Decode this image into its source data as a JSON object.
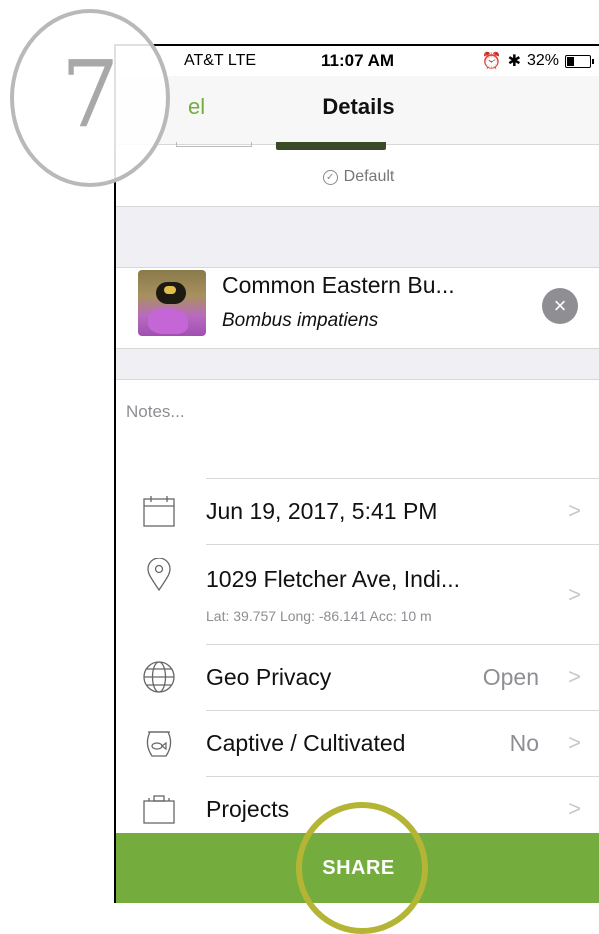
{
  "step": {
    "number": "7"
  },
  "status_bar": {
    "carrier": "AT&T  LTE",
    "time": "11:07 AM",
    "alarm_icon": "alarm-icon",
    "bluetooth_icon": "bluetooth-icon",
    "battery": "32%"
  },
  "nav": {
    "cancel_label": "el",
    "title": "Details"
  },
  "photo": {
    "default_label": "Default"
  },
  "taxon": {
    "common_name": "Common Eastern Bu...",
    "scientific_name": "Bombus impatiens",
    "clear_icon": "clear-icon"
  },
  "notes": {
    "placeholder": "Notes..."
  },
  "rows": {
    "date": {
      "label": "Jun 19, 2017, 5:41 PM",
      "icon": "calendar-icon"
    },
    "location": {
      "label": "1029 Fletcher Ave, Indi...",
      "sub": "Lat: 39.757  Long: -86.141  Acc: 10 m",
      "icon": "map-pin-icon"
    },
    "geo_privacy": {
      "label": "Geo Privacy",
      "value": "Open",
      "icon": "globe-icon"
    },
    "captive": {
      "label": "Captive / Cultivated",
      "value": "No",
      "icon": "fishbowl-icon"
    },
    "projects": {
      "label": "Projects",
      "icon": "briefcase-icon"
    }
  },
  "share": {
    "label": "SHARE"
  },
  "colors": {
    "accent_green": "#74ac3e",
    "highlight_ring": "#b4b535",
    "secondary_text": "#8e8e93"
  }
}
